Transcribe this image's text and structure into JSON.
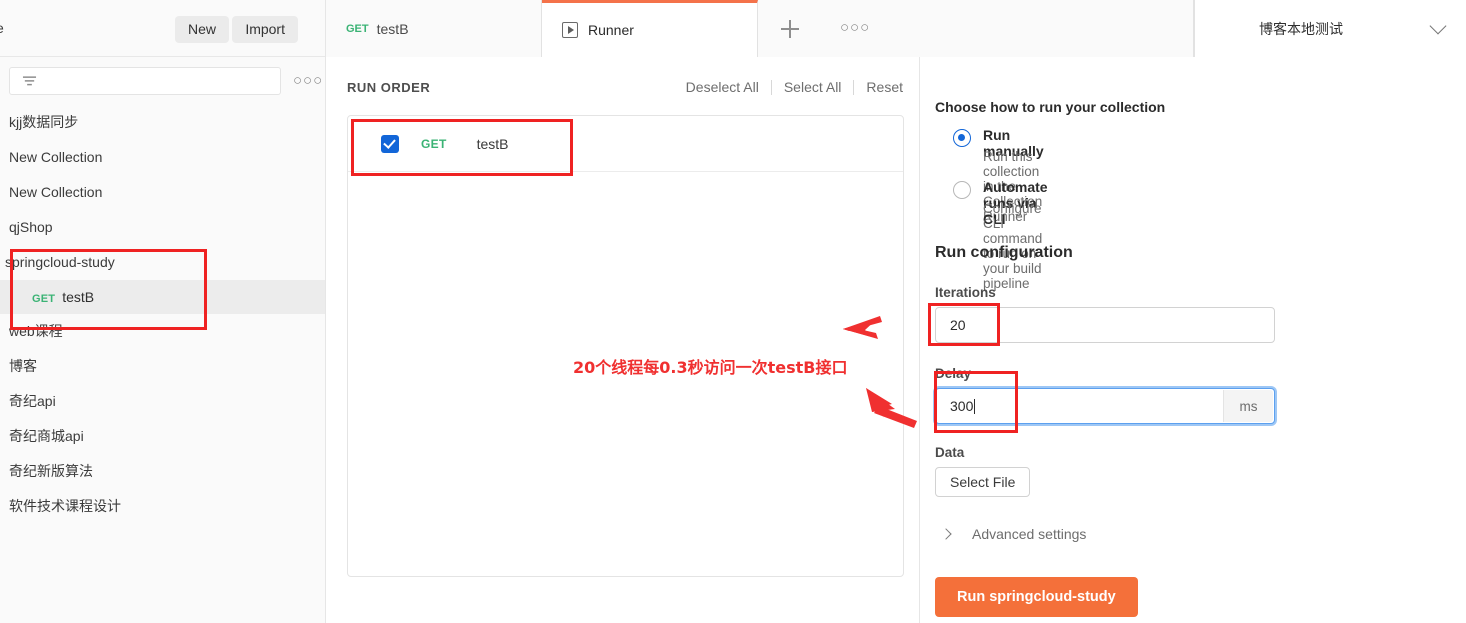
{
  "sidebar": {
    "cut_label": "e",
    "new_label": "New",
    "import_label": "Import",
    "filter_icon": "filter-funnel-icon",
    "more_icon": "ellipsis-icon",
    "more_glyph": "○○○",
    "collections": [
      {
        "label": "kjj数据同步"
      },
      {
        "label": "New Collection"
      },
      {
        "label": "New Collection"
      },
      {
        "label": "qjShop"
      },
      {
        "label": "springcloud-study"
      }
    ],
    "request": {
      "method": "GET",
      "name": "testB"
    },
    "collections_after": [
      {
        "label": "web课程"
      },
      {
        "label": "博客"
      },
      {
        "label": "奇纪api"
      },
      {
        "label": "奇纪商城api"
      },
      {
        "label": "奇纪新版算法"
      },
      {
        "label": "软件技术课程设计"
      }
    ]
  },
  "tabs": {
    "request_tab": {
      "method": "GET",
      "label": "testB"
    },
    "runner_tab": {
      "label": "Runner",
      "icon": "play-square-icon"
    },
    "new_tab_icon": "plus-icon",
    "tab_more_icon": "ellipsis-icon",
    "tab_more_glyph": "○○○",
    "environment": {
      "name": "博客本地测试",
      "chevron": "chevron-down-icon"
    }
  },
  "run_order": {
    "title": "RUN ORDER",
    "deselect_all": "Deselect All",
    "select_all": "Select All",
    "reset": "Reset",
    "rows": [
      {
        "checked": true,
        "method": "GET",
        "name": "testB"
      }
    ]
  },
  "config": {
    "choose_heading": "Choose how to run your collection",
    "options": [
      {
        "title": "Run manually",
        "subtitle": "Run this collection in the Collection Runner",
        "selected": true
      },
      {
        "title": "Automate runs via CLI",
        "subtitle": "Configure CLI command to run on your build pipeline",
        "selected": false
      }
    ],
    "run_config_heading": "Run configuration",
    "iterations_label": "Iterations",
    "iterations_value": "20",
    "delay_label": "Delay",
    "delay_value": "300",
    "delay_unit": "ms",
    "data_label": "Data",
    "select_file_label": "Select File",
    "advanced_label": "Advanced settings",
    "run_button_label": "Run springcloud-study"
  },
  "annotation": {
    "text": "20个线程每0.3秒访问一次testB接口",
    "color": "#f03030"
  },
  "colors": {
    "accent_orange": "#f4703a",
    "checkbox_blue": "#1266d8",
    "method_green": "#3bb375",
    "annotation_red": "#ef2222",
    "focus_blue": "#5ca0ef"
  }
}
